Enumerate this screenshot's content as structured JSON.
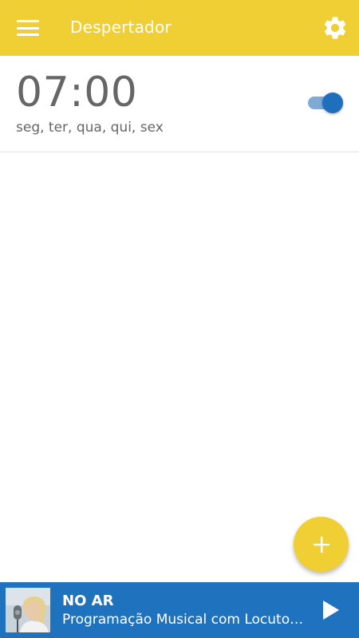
{
  "app_bar": {
    "title": "Despertador",
    "menu_icon": "hamburger-menu-icon",
    "settings_icon": "gear-icon",
    "color": "#efcf33"
  },
  "alarms": [
    {
      "time": "07:00",
      "days": "seg, ter, qua, qui, sex",
      "enabled": true
    }
  ],
  "fab": {
    "icon": "plus-icon",
    "color": "#efcf33"
  },
  "player": {
    "status": "NO AR",
    "program": "Programação Musical com Locutor Virtual",
    "thumbnail": "presenter-photo",
    "play_icon": "play-icon",
    "color": "#1f72bd"
  },
  "colors": {
    "toggle_track": "#7fa9d6",
    "toggle_thumb": "#1f6fbd",
    "text_secondary": "#666666"
  }
}
